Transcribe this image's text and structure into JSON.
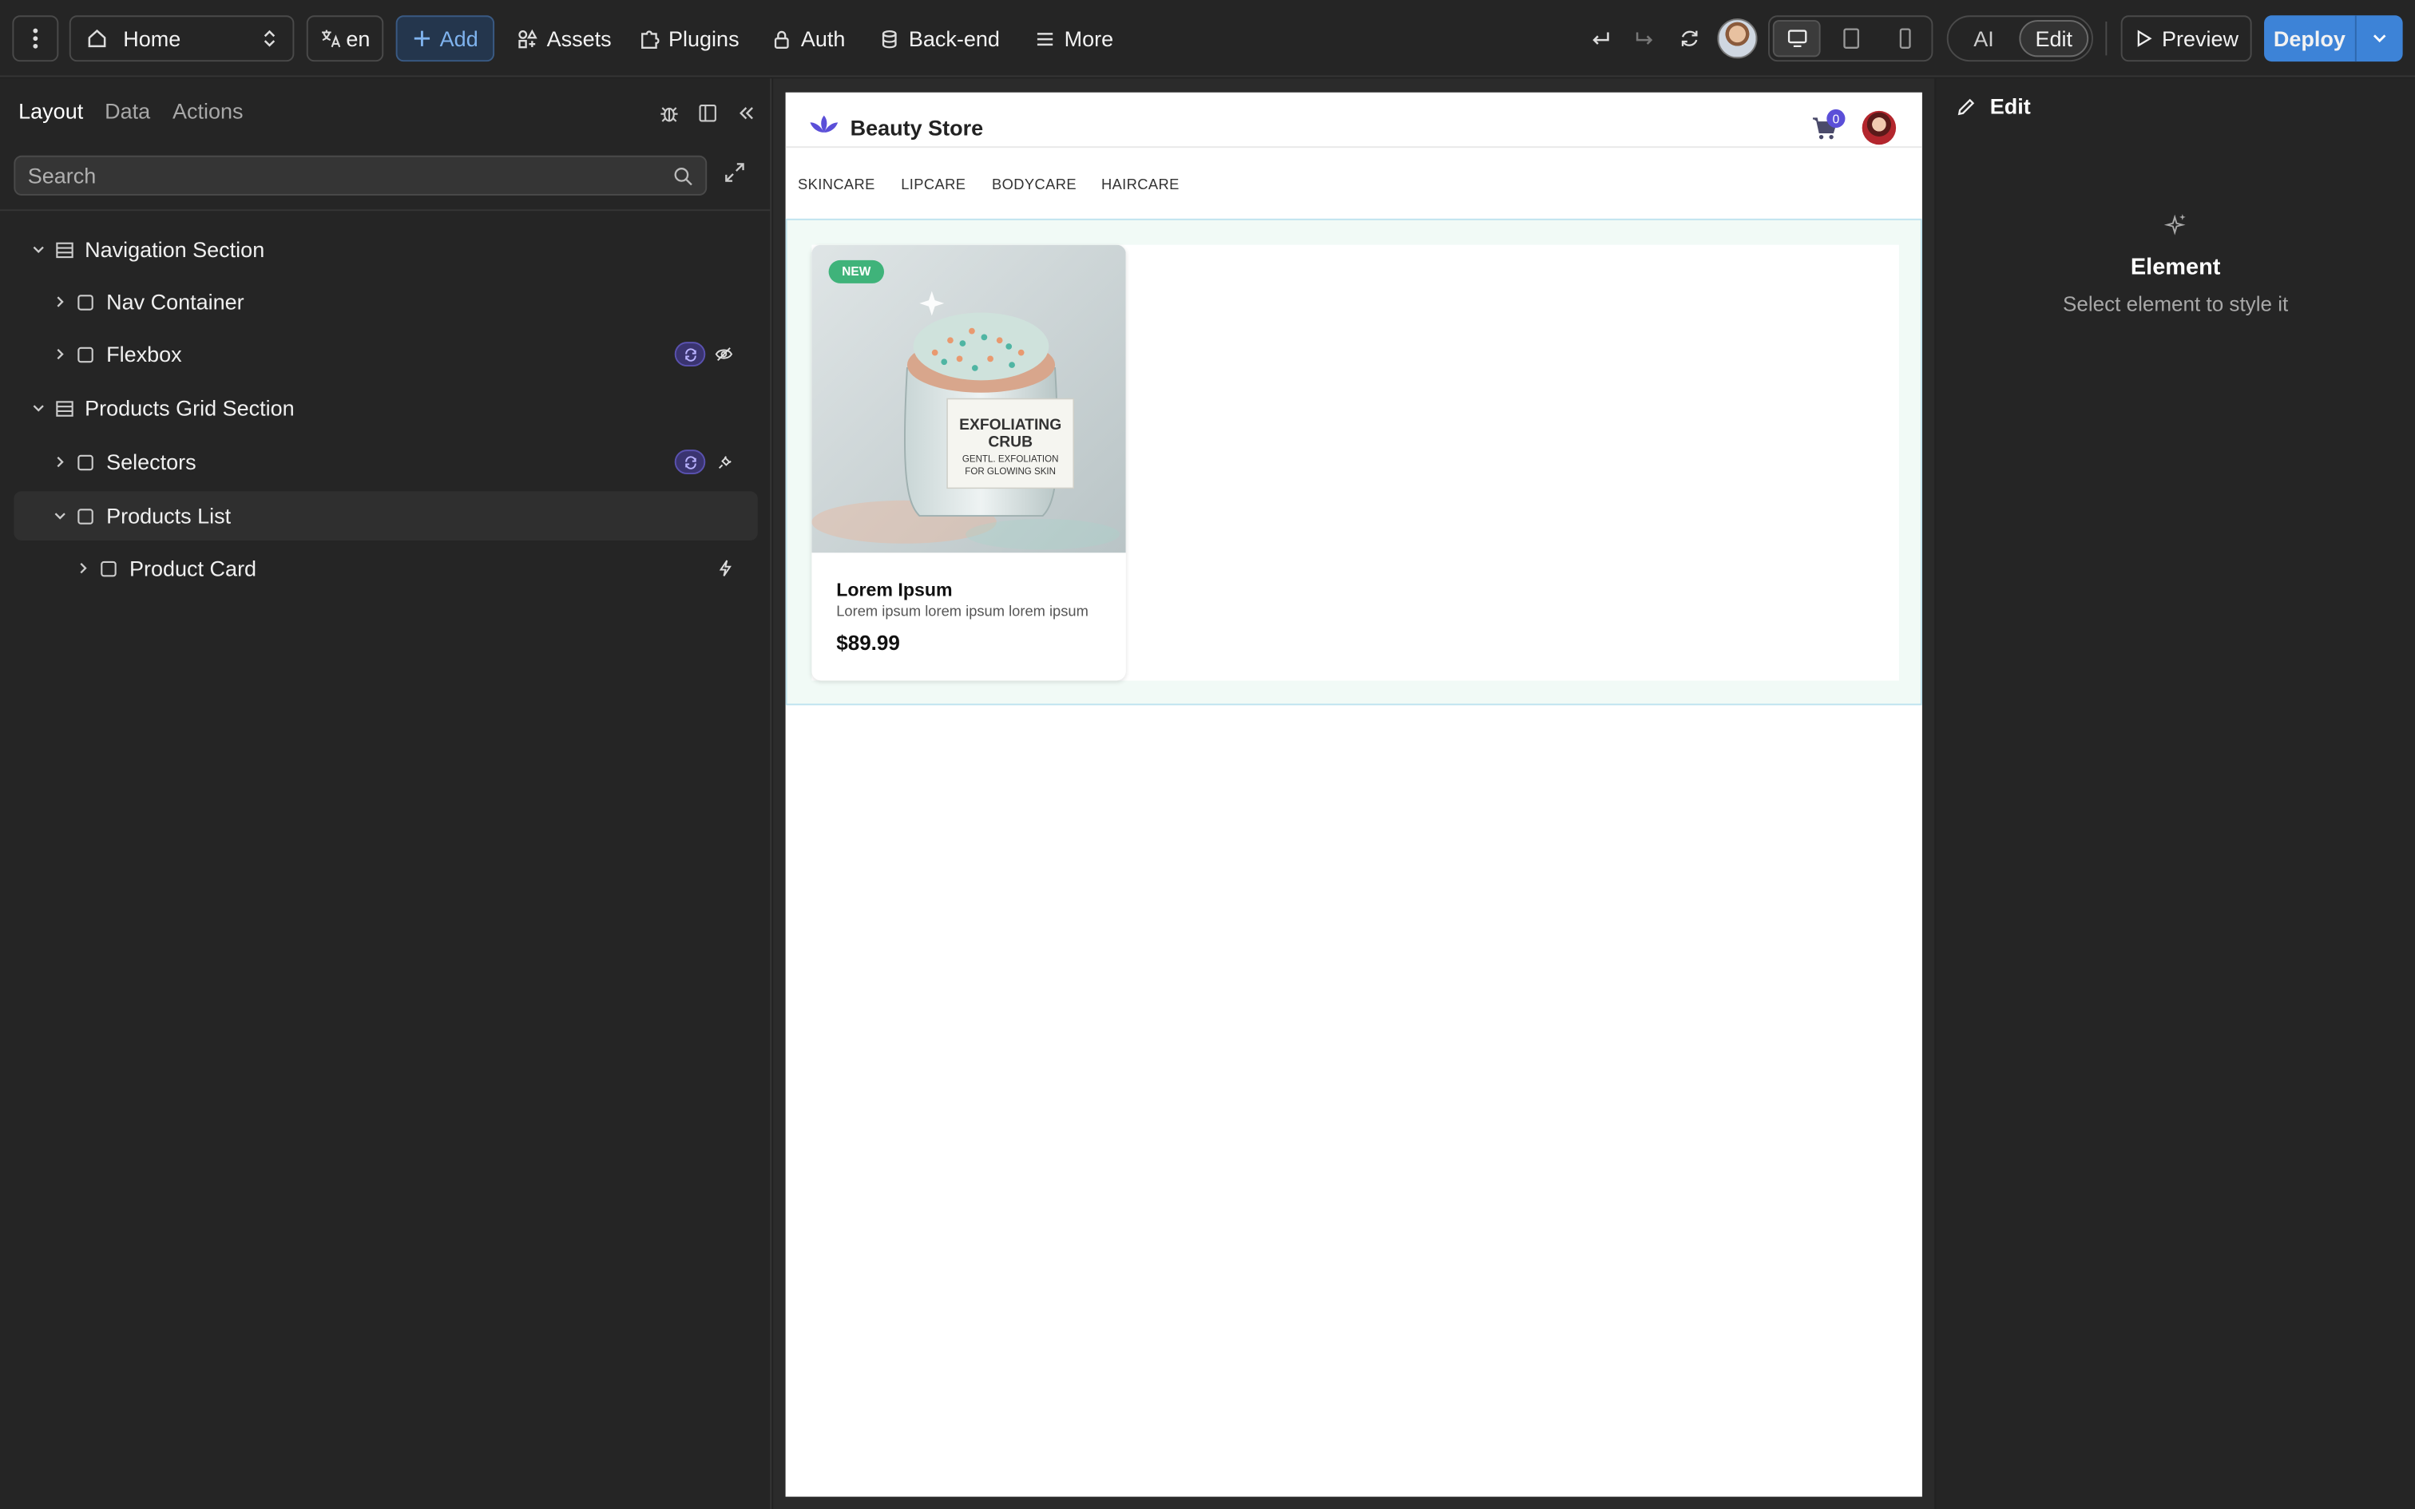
{
  "toolbar": {
    "page_select_label": "Home",
    "lang_label": "en",
    "add_label": "Add",
    "nav": [
      {
        "label": "Assets",
        "icon": "assets-icon"
      },
      {
        "label": "Plugins",
        "icon": "puzzle-icon"
      },
      {
        "label": "Auth",
        "icon": "lock-icon"
      },
      {
        "label": "Back-end",
        "icon": "database-icon"
      },
      {
        "label": "More",
        "icon": "menu-icon"
      }
    ],
    "mode_ai": "AI",
    "mode_edit": "Edit",
    "active_mode": "Edit",
    "active_device": "desktop",
    "preview_label": "Preview",
    "deploy_label": "Deploy"
  },
  "left_panel": {
    "tabs": [
      "Layout",
      "Data",
      "Actions"
    ],
    "active_tab": "Layout",
    "search_placeholder": "Search",
    "tree": [
      {
        "label": "Navigation Section",
        "depth": 0,
        "expanded": true,
        "type": "section"
      },
      {
        "label": "Nav Container",
        "depth": 1,
        "expanded": false,
        "type": "element"
      },
      {
        "label": "Flexbox",
        "depth": 1,
        "expanded": false,
        "type": "element",
        "badges": [
          "sync",
          "hidden"
        ]
      },
      {
        "label": "Products Grid Section",
        "depth": 0,
        "expanded": true,
        "type": "section"
      },
      {
        "label": "Selectors",
        "depth": 1,
        "expanded": false,
        "type": "element",
        "badges": [
          "sync",
          "bound"
        ]
      },
      {
        "label": "Products List",
        "depth": 1,
        "expanded": true,
        "type": "element",
        "selected": true
      },
      {
        "label": "Product Card",
        "depth": 2,
        "expanded": false,
        "type": "element",
        "badges": [
          "action"
        ]
      }
    ]
  },
  "site": {
    "brand": "Beauty Store",
    "cart_count": "0",
    "categories": [
      "SKINCARE",
      "LIPCARE",
      "BODYCARE",
      "HAIRCARE"
    ],
    "product": {
      "badge": "NEW",
      "title": "Lorem Ipsum",
      "description": "Lorem ipsum lorem ipsum lorem ipsum",
      "price": "$89.99",
      "jar_label_1": "EXFOLIATING",
      "jar_label_2": "CRUB",
      "jar_label_3": "GENTL. EXFOLIATION",
      "jar_label_4": "FOR GLOWING SKIN"
    }
  },
  "right_panel": {
    "header": "Edit",
    "title": "Element",
    "subtitle": "Select element to style it"
  },
  "colors": {
    "accent": "#3d83d7",
    "brand_purple": "#5b4fd8",
    "badge_green": "#3fb37a",
    "panel_bg": "#252525"
  }
}
